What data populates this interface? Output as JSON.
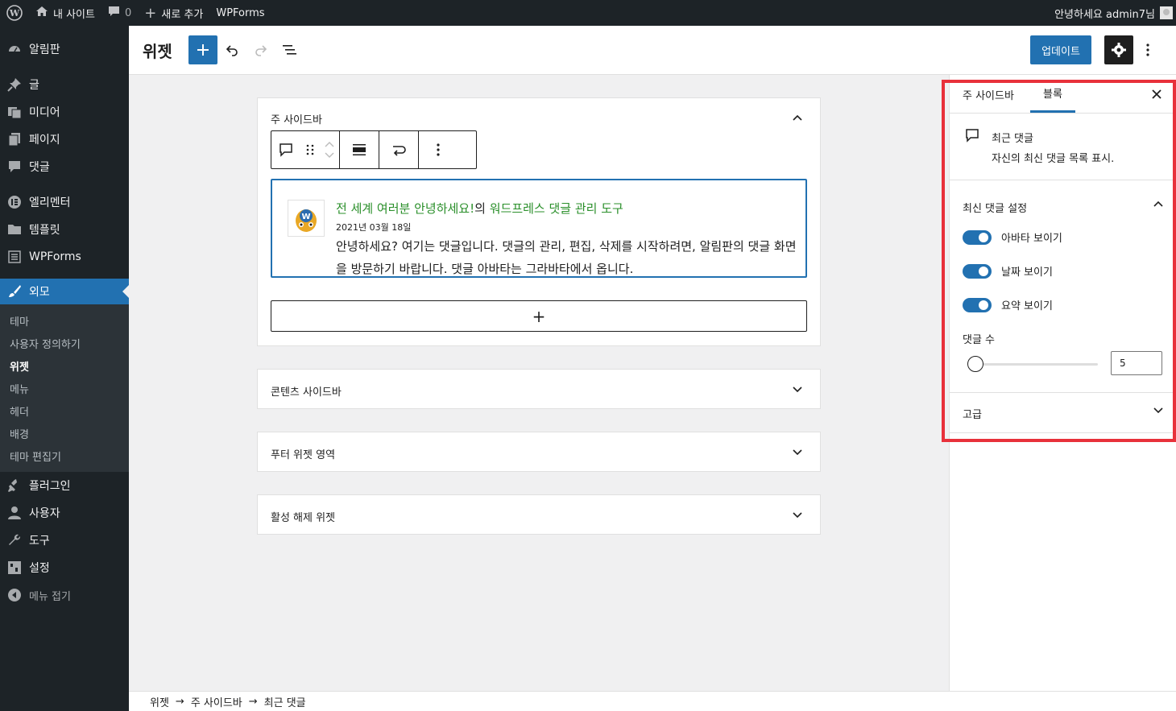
{
  "adminbar": {
    "site_name": "내 사이트",
    "comments_count": "0",
    "new_label": "새로 추가",
    "wpforms": "WPForms",
    "greeting": "안녕하세요 admin7님"
  },
  "menu": {
    "dashboard": "알림판",
    "posts": "글",
    "media": "미디어",
    "pages": "페이지",
    "comments": "댓글",
    "elementor": "엘리멘터",
    "templates": "템플릿",
    "wpforms": "WPForms",
    "appearance": "외모",
    "submenu": [
      "테마",
      "사용자 정의하기",
      "위젯",
      "메뉴",
      "헤더",
      "배경",
      "테마 편집기"
    ],
    "plugins": "플러그인",
    "users": "사용자",
    "tools": "도구",
    "settings": "설정",
    "collapse": "메뉴 접기"
  },
  "header": {
    "title": "위젯",
    "update_label": "업데이트"
  },
  "canvas": {
    "main_sidebar": "주 사이드바",
    "comment": {
      "author": "전 세계 여러분 안녕하세요!",
      "connector": "의",
      "post": "워드프레스 댓글 관리 도구",
      "date": "2021년 03월 18일",
      "text": "안녕하세요? 여기는 댓글입니다. 댓글의 관리, 편집, 삭제를 시작하려면, 알림판의 댓글 화면을 방문하기 바랍니다. 댓글 아바타는 그라바타에서 옵니다."
    },
    "appender": "+",
    "areas": [
      "콘텐츠 사이드바",
      "푸터 위젯 영역",
      "활성 해제 위젯"
    ]
  },
  "sidebar": {
    "tab_area": "주 사이드바",
    "tab_block": "블록",
    "block_name": "최근 댓글",
    "block_desc": "자신의 최신 댓글 목록 표시.",
    "panel_title": "최신 댓글 설정",
    "toggle_avatar": "아바타 보이기",
    "toggle_date": "날짜 보이기",
    "toggle_excerpt": "요약 보이기",
    "count_label": "댓글 수",
    "count_value": "5",
    "advanced": "고급"
  },
  "breadcrumb": [
    "위젯",
    "주 사이드바",
    "최근 댓글"
  ],
  "colors": {
    "accent": "#2271b1",
    "admin_dark": "#1d2327",
    "highlight": "#e8313b",
    "link_green": "#2a8f2a"
  }
}
